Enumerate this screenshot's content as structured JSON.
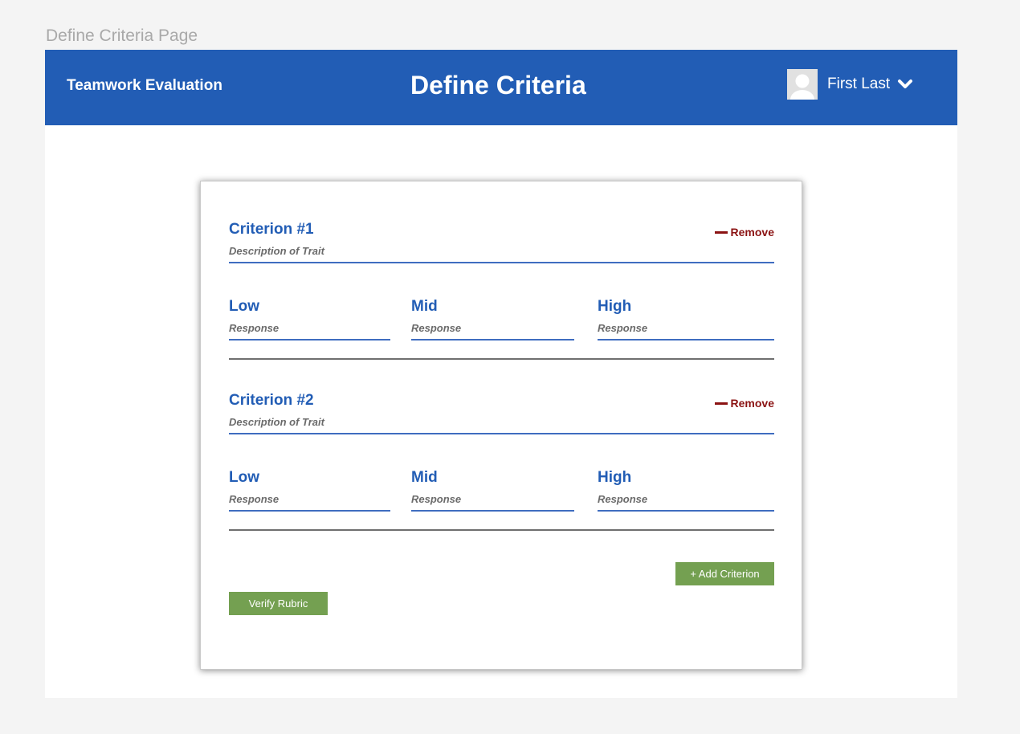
{
  "page_label": "Define Criteria Page",
  "header": {
    "app_title": "Teamwork Evaluation",
    "page_title": "Define Criteria",
    "user_name": "First Last"
  },
  "criteria": [
    {
      "title": "Criterion #1",
      "remove_label": "Remove",
      "description_placeholder": "Description of Trait",
      "levels": [
        {
          "label": "Low",
          "response_placeholder": "Response"
        },
        {
          "label": "Mid",
          "response_placeholder": "Response"
        },
        {
          "label": "High",
          "response_placeholder": "Response"
        }
      ]
    },
    {
      "title": "Criterion #2",
      "remove_label": "Remove",
      "description_placeholder": "Description of Trait",
      "levels": [
        {
          "label": "Low",
          "response_placeholder": "Response"
        },
        {
          "label": "Mid",
          "response_placeholder": "Response"
        },
        {
          "label": "High",
          "response_placeholder": "Response"
        }
      ]
    }
  ],
  "actions": {
    "add_criterion_label": "+ Add Criterion",
    "verify_rubric_label": "Verify Rubric"
  },
  "colors": {
    "header_bg": "#225db5",
    "accent_blue": "#225db5",
    "remove_red": "#8b1313",
    "button_green": "#74a051",
    "page_bg": "#f4f4f4"
  },
  "icons": {
    "avatar": "user-avatar-icon",
    "menu_toggle": "chevron-down-icon",
    "remove": "minus-icon"
  }
}
